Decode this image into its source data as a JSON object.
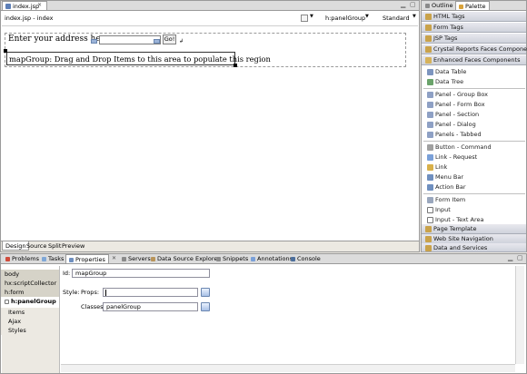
{
  "editor": {
    "tab_title": "index.jsp",
    "breadcrumb": "index.jsp - index",
    "component_dropdown": "h:panelGroup",
    "mode_dropdown": "Standard",
    "canvas": {
      "address_label": "Enter your address here:",
      "go_button": "Go!",
      "panel_text": "mapGroup: Drag and Drop Items to this area to populate this region"
    },
    "view_tabs": [
      "Design",
      "Source",
      "Split",
      "Preview"
    ]
  },
  "right_panel": {
    "tabs": [
      "Outline",
      "Palette"
    ],
    "drawers": [
      "HTML Tags",
      "Form Tags",
      "JSP Tags",
      "Crystal Reports Faces Components",
      "Enhanced Faces Components"
    ],
    "efc_items_group1": [
      "Data Table",
      "Data Tree"
    ],
    "efc_items_group2": [
      "Panel - Group Box",
      "Panel - Form Box",
      "Panel - Section",
      "Panel - Dialog",
      "Panels - Tabbed"
    ],
    "efc_items_group3": [
      "Button - Command",
      "Link - Request",
      "Link",
      "Menu Bar",
      "Action Bar"
    ],
    "efc_items_group4": [
      "Form Item",
      "Input",
      "Input - Text Area"
    ],
    "bottom_drawers": [
      "Page Template",
      "Web Site Navigation",
      "Data and Services"
    ]
  },
  "bottom_tabs": [
    "Problems",
    "Tasks",
    "Properties",
    "Servers",
    "Data Source Explorer",
    "Snippets",
    "Annotations",
    "Console"
  ],
  "properties": {
    "left_items": [
      "body",
      "hx:scriptCollector",
      "h:form",
      "h:panelGroup",
      "Items",
      "Ajax",
      "Styles"
    ],
    "id_label": "Id:",
    "id_value": "mapGroup",
    "style_label": "Style:",
    "props_label": "Props:",
    "props_value": "",
    "classes_label": "Classes:",
    "classes_value": "panelGroup"
  }
}
